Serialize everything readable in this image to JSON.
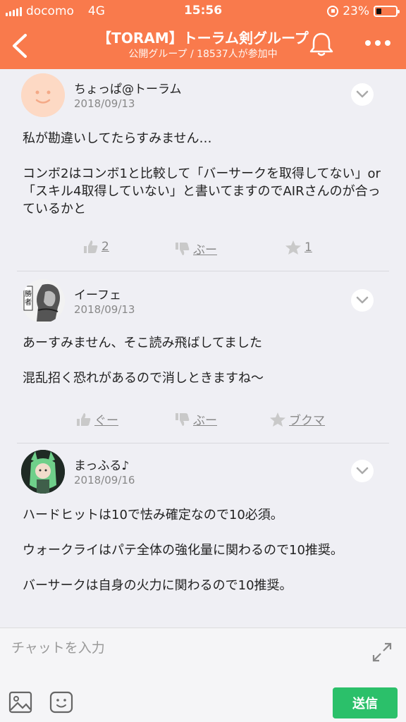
{
  "status_bar": {
    "carrier": "docomo",
    "network": "4G",
    "time": "15:56",
    "battery": "23%"
  },
  "header": {
    "title": "【TORAM】トーラム剣グループ",
    "subtitle": "公開グループ / 18537人が参加中",
    "bg_color": "#f97a4c"
  },
  "posts": [
    {
      "author": "ちょっぱ@トーラム",
      "date": "2018/09/13",
      "body": "私が勘違いしてたらすみません…\n\nコンボ2はコンボ1と比較して「バーサークを取得してない」or「スキル4取得していない」と書いてますのでAIRさんのが合っているかと",
      "actions": {
        "like": "2",
        "dislike": "ぶー",
        "bookmark": "1"
      }
    },
    {
      "author": "イーフェ",
      "date": "2018/09/13",
      "body": "あーすみません、そこ読み飛ばしてました\n\n混乱招く恐れがあるので消しときますね〜",
      "actions": {
        "like": "ぐー",
        "dislike": "ぶー",
        "bookmark": "ブクマ"
      }
    },
    {
      "author": "まっふる♪",
      "date": "2018/09/16",
      "body": "ハードヒットは10で怯み確定なので10必須。\n\nウォークライはパテ全体の強化量に関わるので10推奨。\n\nバーサークは自身の火力に関わるので10推奨。"
    }
  ],
  "input_bar": {
    "placeholder": "チャットを入力",
    "send_label": "送信",
    "send_color": "#2bc06a"
  }
}
